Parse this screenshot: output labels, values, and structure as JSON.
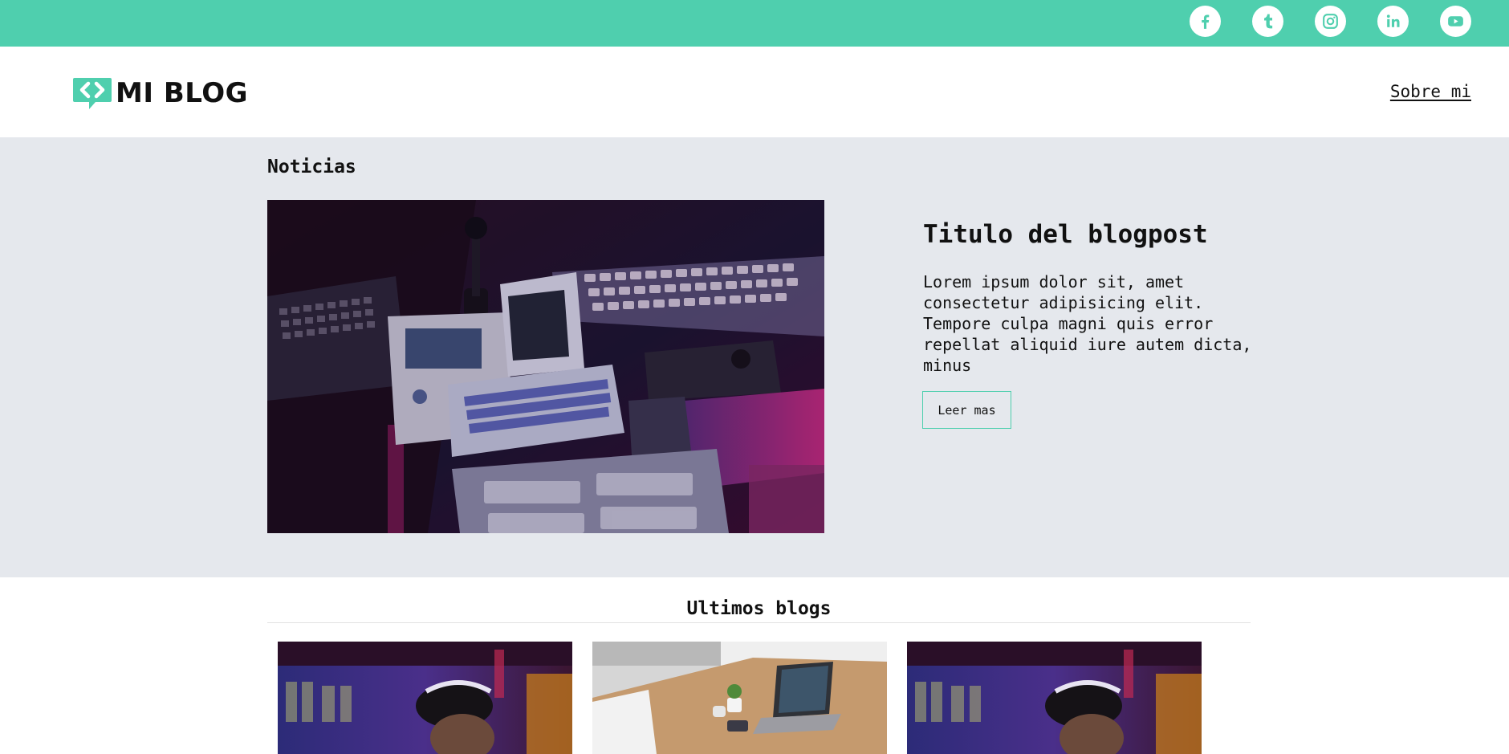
{
  "social": {
    "icons": [
      "facebook-icon",
      "tumblr-icon",
      "instagram-icon",
      "linkedin-icon",
      "youtube-icon"
    ]
  },
  "header": {
    "logo_text": "MI BLOG",
    "nav_about": "Sobre mi"
  },
  "featured": {
    "section_label": "Noticias",
    "post_title": "Titulo del blogpost",
    "post_text": "Lorem ipsum dolor sit, amet consectetur adipisicing elit. Tempore culpa magni quis error repellat aliquid iure autem dicta, minus",
    "read_more": "Leer mas"
  },
  "latest": {
    "title": "Ultimos blogs"
  },
  "colors": {
    "accent": "#4fcfae",
    "hero_bg": "#e5e8ed",
    "text": "#111111"
  }
}
